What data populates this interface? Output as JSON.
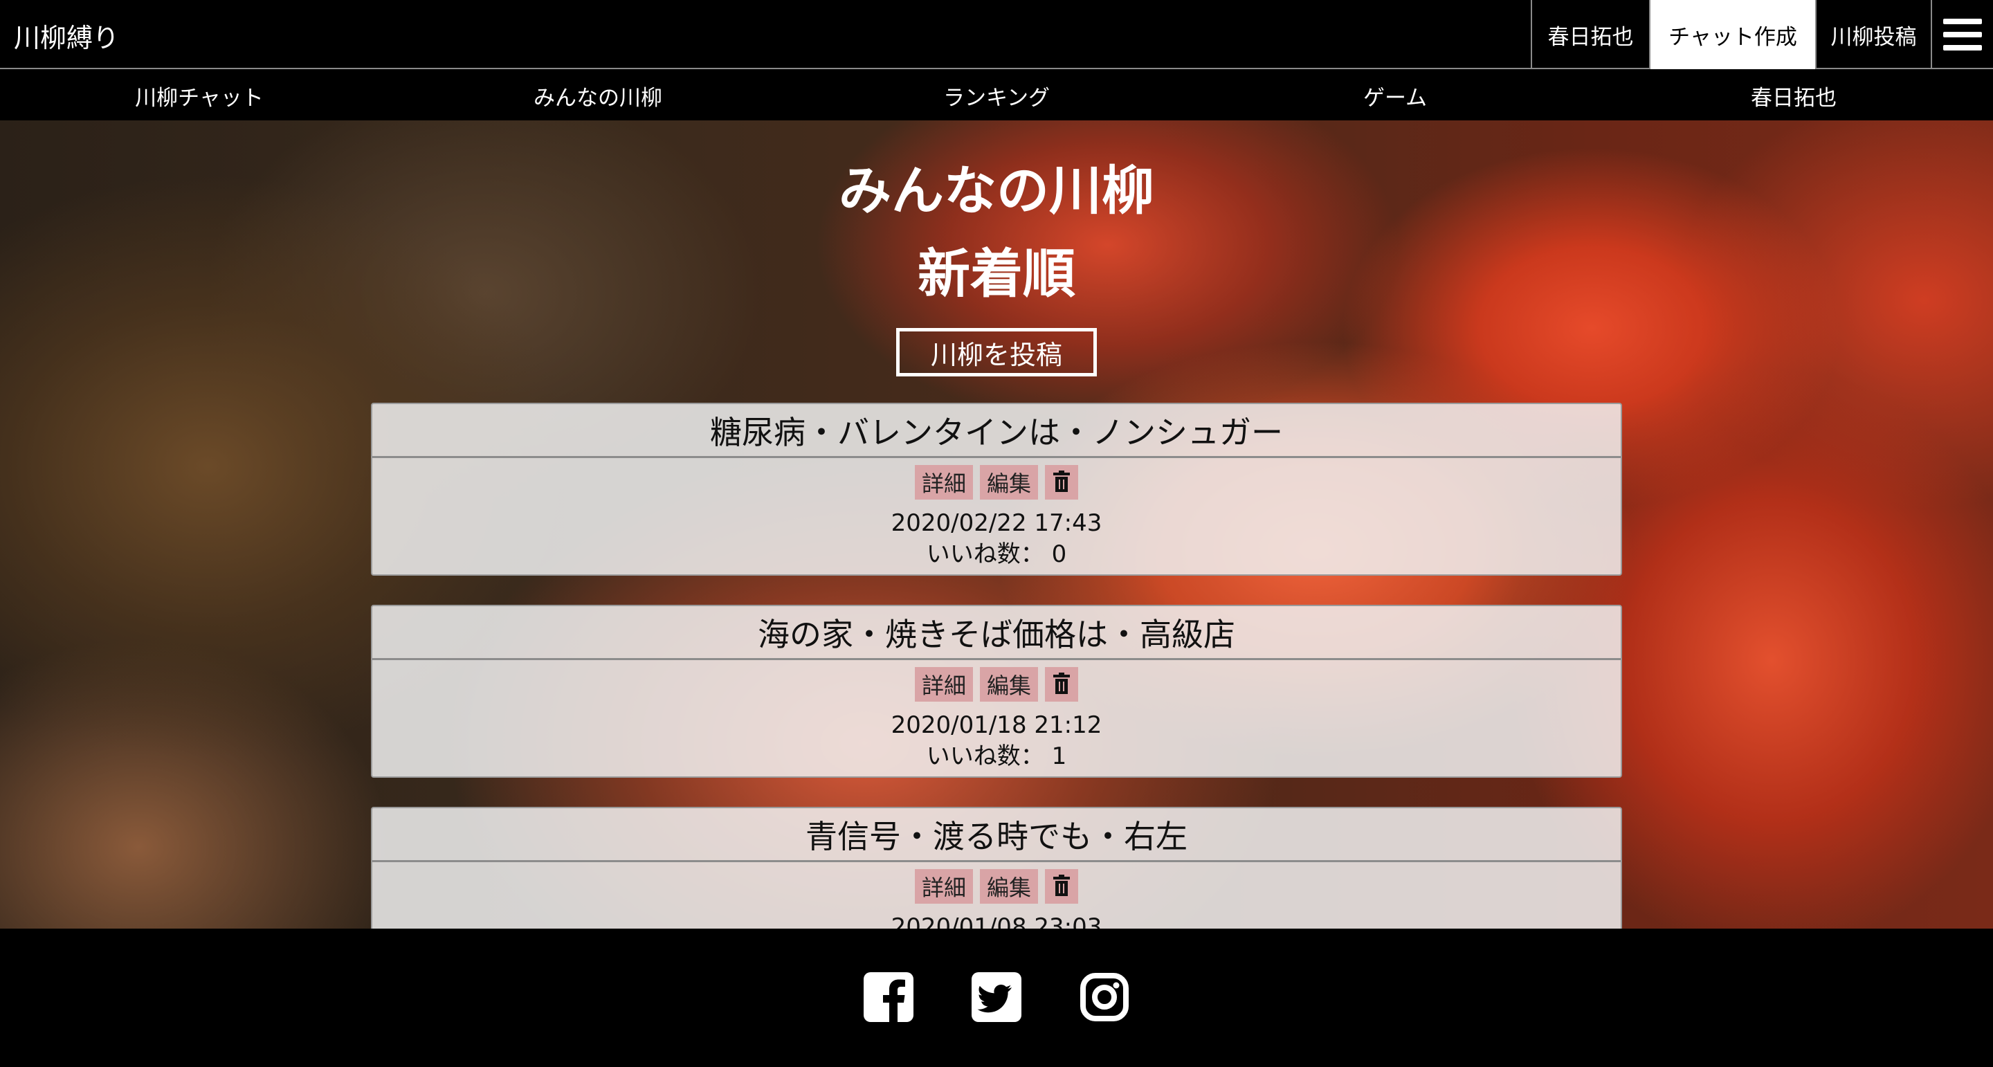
{
  "header": {
    "logo": "川柳縛り",
    "user_label": "春日拓也",
    "chat_create_label": "チャット作成",
    "senryu_post_label": "川柳投稿"
  },
  "subnav": {
    "items": [
      {
        "label": "川柳チャット"
      },
      {
        "label": "みんなの川柳"
      },
      {
        "label": "ランキング"
      },
      {
        "label": "ゲーム"
      },
      {
        "label": "春日拓也"
      }
    ]
  },
  "main": {
    "title": "みんなの川柳",
    "sort_label": "新着順",
    "post_button": "川柳を投稿",
    "posts": [
      {
        "text": "糖尿病・バレンタインは・ノンシュガー",
        "detail": "詳細",
        "edit": "編集",
        "date": "2020/02/22 17:43",
        "likes": "いいね数： 0"
      },
      {
        "text": "海の家・焼きそば価格は・高級店",
        "detail": "詳細",
        "edit": "編集",
        "date": "2020/01/18 21:12",
        "likes": "いいね数： 1"
      },
      {
        "text": "青信号・渡る時でも・右左",
        "detail": "詳細",
        "edit": "編集",
        "date": "2020/01/08 23:03",
        "likes": ""
      }
    ]
  },
  "footer": {
    "icons": [
      "facebook-icon",
      "twitter-icon",
      "instagram-icon"
    ]
  },
  "colors": {
    "background": "#000000",
    "card_bg": "#f0f0f0",
    "action_bg": "#d9a4a6",
    "accent_white": "#ffffff"
  }
}
